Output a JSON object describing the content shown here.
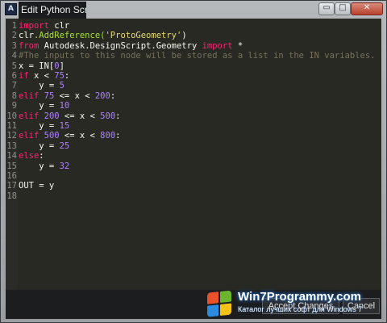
{
  "window": {
    "title": "Edit Python Script...",
    "app_icon_letter": "A",
    "controls": {
      "minimize": "▭",
      "maximize": "□",
      "close": "✕"
    }
  },
  "editor": {
    "lines": [
      {
        "n": "1",
        "tokens": [
          {
            "t": "import",
            "c": "kw"
          },
          {
            "t": " clr",
            "c": ""
          }
        ]
      },
      {
        "n": "2",
        "tokens": [
          {
            "t": "clr",
            "c": ""
          },
          {
            "t": ".AddReference(",
            "c": "fn"
          },
          {
            "t": "'ProtoGeometry'",
            "c": "str"
          },
          {
            "t": ")",
            "c": ""
          }
        ]
      },
      {
        "n": "3",
        "tokens": [
          {
            "t": "from",
            "c": "kw"
          },
          {
            "t": " Autodesk.DesignScript.Geometry ",
            "c": ""
          },
          {
            "t": "import",
            "c": "kw"
          },
          {
            "t": " *",
            "c": ""
          }
        ]
      },
      {
        "n": "4",
        "tokens": [
          {
            "t": "#The inputs to this node will be stored as a list in the IN variables.",
            "c": "cmt"
          }
        ]
      },
      {
        "n": "5",
        "tokens": [
          {
            "t": "x = IN[",
            "c": ""
          },
          {
            "t": "0",
            "c": "num"
          },
          {
            "t": "]",
            "c": ""
          }
        ]
      },
      {
        "n": "6",
        "tokens": [
          {
            "t": "if",
            "c": "kw"
          },
          {
            "t": " x < ",
            "c": ""
          },
          {
            "t": "75",
            "c": "num"
          },
          {
            "t": ":",
            "c": ""
          }
        ]
      },
      {
        "n": "7",
        "tokens": [
          {
            "t": "    y = ",
            "c": ""
          },
          {
            "t": "5",
            "c": "num"
          }
        ]
      },
      {
        "n": "8",
        "tokens": [
          {
            "t": "elif",
            "c": "kw"
          },
          {
            "t": " ",
            "c": ""
          },
          {
            "t": "75",
            "c": "num"
          },
          {
            "t": " <= x < ",
            "c": ""
          },
          {
            "t": "200",
            "c": "num"
          },
          {
            "t": ":",
            "c": ""
          }
        ]
      },
      {
        "n": "9",
        "tokens": [
          {
            "t": "    y = ",
            "c": ""
          },
          {
            "t": "10",
            "c": "num"
          }
        ]
      },
      {
        "n": "10",
        "tokens": [
          {
            "t": "elif",
            "c": "kw"
          },
          {
            "t": " ",
            "c": ""
          },
          {
            "t": "200",
            "c": "num"
          },
          {
            "t": " <= x < ",
            "c": ""
          },
          {
            "t": "500",
            "c": "num"
          },
          {
            "t": ":",
            "c": ""
          }
        ]
      },
      {
        "n": "11",
        "tokens": [
          {
            "t": "    y = ",
            "c": ""
          },
          {
            "t": "15",
            "c": "num"
          }
        ]
      },
      {
        "n": "12",
        "tokens": [
          {
            "t": "elif",
            "c": "kw"
          },
          {
            "t": " ",
            "c": ""
          },
          {
            "t": "500",
            "c": "num"
          },
          {
            "t": " <= x < ",
            "c": ""
          },
          {
            "t": "800",
            "c": "num"
          },
          {
            "t": ":",
            "c": ""
          }
        ]
      },
      {
        "n": "13",
        "tokens": [
          {
            "t": "    y = ",
            "c": ""
          },
          {
            "t": "25",
            "c": "num"
          }
        ]
      },
      {
        "n": "14",
        "tokens": [
          {
            "t": "else",
            "c": "kw"
          },
          {
            "t": ":",
            "c": ""
          }
        ]
      },
      {
        "n": "15",
        "tokens": [
          {
            "t": "    y = ",
            "c": ""
          },
          {
            "t": "32",
            "c": "num"
          }
        ]
      },
      {
        "n": "16",
        "tokens": []
      },
      {
        "n": "17",
        "tokens": [
          {
            "t": "OUT = y",
            "c": ""
          }
        ]
      },
      {
        "n": "18",
        "tokens": []
      }
    ]
  },
  "buttons": {
    "accept": "Accept Changes",
    "cancel": "Cancel"
  },
  "watermark": {
    "title": "Win7Programmy.com",
    "subtitle": "Каталог лучших софт для Windows 7",
    "logo_colors": [
      "#e8512a",
      "#6bb52f",
      "#2a8be0",
      "#f4c318"
    ]
  }
}
